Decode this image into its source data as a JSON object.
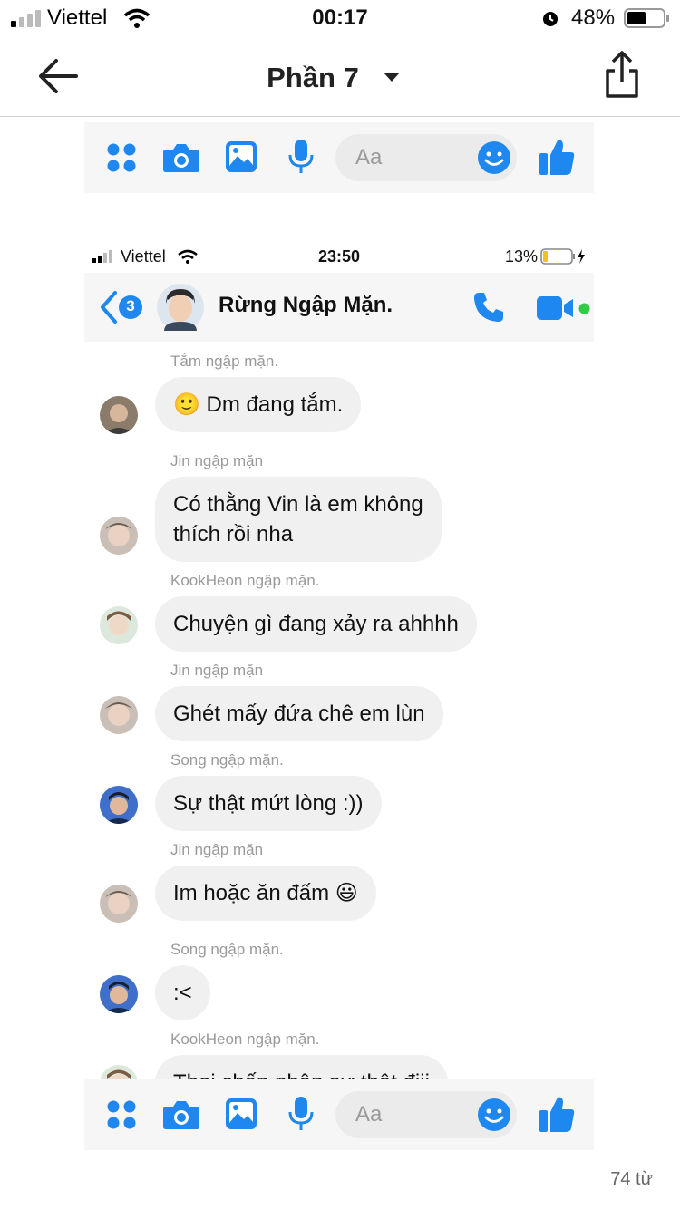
{
  "status_bar": {
    "carrier": "Viettel",
    "time": "00:17",
    "battery": "48%"
  },
  "header": {
    "title": "Phần 7"
  },
  "composer": {
    "placeholder": "Aa"
  },
  "inner_status_bar": {
    "carrier": "Viettel",
    "time": "23:50",
    "battery": "13%"
  },
  "chat": {
    "name": "Rừng Ngập Mặn.",
    "back_badge": "3",
    "messages": [
      {
        "sender": "Tắm ngập mặn.",
        "text": "🙂 Dm đang tắm."
      },
      {
        "sender": "Jin ngập mặn",
        "text": "Có thằng Vin là em không",
        "text2": "thích rồi nha"
      },
      {
        "sender": "KookHeon ngập mặn.",
        "text": "Chuyện gì đang xảy ra ahhhh"
      },
      {
        "sender": "Jin ngập mặn",
        "text": "Ghét mấy đứa chê em lùn"
      },
      {
        "sender": "Song ngập mặn.",
        "text": "Sự thật mứt lòng :))"
      },
      {
        "sender": "Jin ngập mặn",
        "text": "Im hoặc ăn đấm 😃"
      },
      {
        "sender": "Song ngập mặn.",
        "text": ":<"
      },
      {
        "sender": "KookHeon ngập mặn.",
        "text": "Thoi chấp nhận sự thật điii"
      }
    ]
  },
  "footer": {
    "word_count": "74 từ"
  },
  "colors": {
    "accent": "#1e88f0",
    "online": "#31cc46",
    "bubble": "#f0f0f0"
  }
}
